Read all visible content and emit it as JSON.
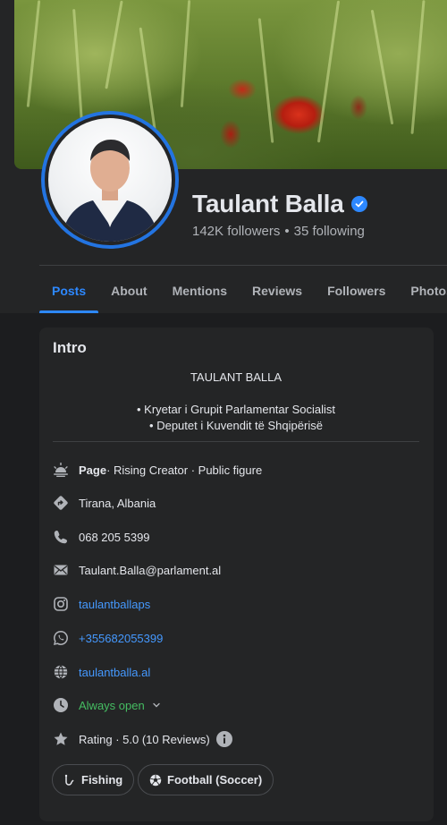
{
  "profile": {
    "name": "Taulant Balla",
    "followers": "142K followers",
    "following": "35 following",
    "separator": "•"
  },
  "tabs": [
    "Posts",
    "About",
    "Mentions",
    "Reviews",
    "Followers",
    "Photos"
  ],
  "active_tab": "Posts",
  "intro": {
    "title": "Intro",
    "bio_heading": "TAULANT BALLA",
    "bio_line_1": "• Kryetar i Grupit Parlamentar Socialist",
    "bio_line_2": "• Deputet i Kuvendit të Shqipërisë",
    "page_label": "Page",
    "page_categories": " · Rising Creator · Public figure",
    "location": "Tirana, Albania",
    "phone": "068 205 5399",
    "email": "Taulant.Balla@parlament.al",
    "instagram": "taulantballaps",
    "whatsapp": "+355682055399",
    "website": "taulantballa.al",
    "hours": "Always open",
    "rating": "Rating · 5.0 (10 Reviews)"
  },
  "interests": [
    {
      "label": "Fishing",
      "icon": "fishing-icon"
    },
    {
      "label": "Football (Soccer)",
      "icon": "soccer-ball-icon"
    }
  ],
  "colors": {
    "accent": "#2d88ff",
    "link": "#4599ff",
    "open_green": "#45bd62",
    "card_bg": "#242526",
    "page_bg": "#1c1d1f"
  }
}
